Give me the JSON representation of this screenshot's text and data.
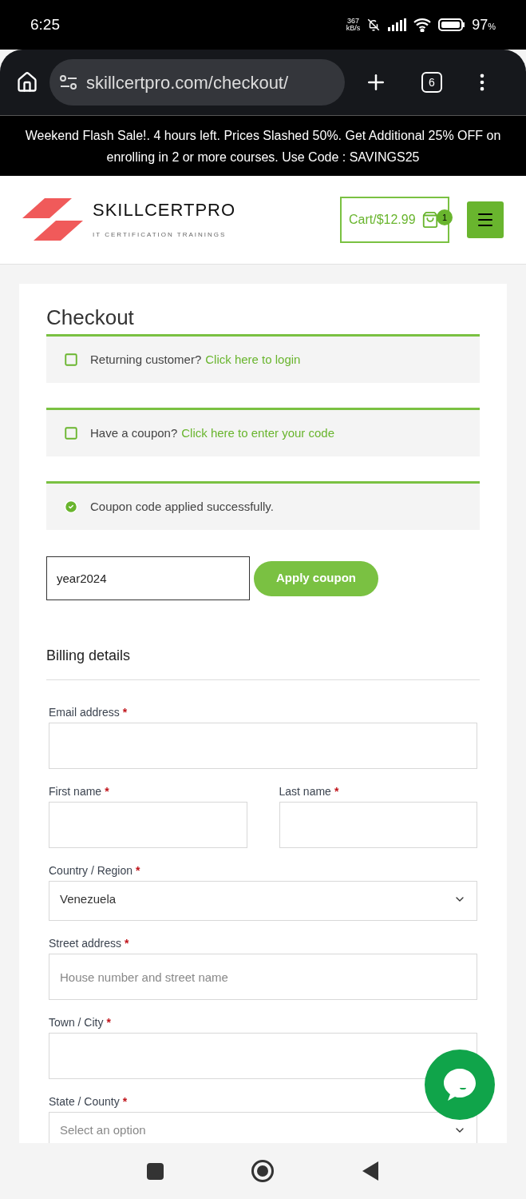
{
  "status_bar": {
    "time": "6:25",
    "net_speed": "367",
    "net_unit": "kB/s",
    "battery": "97",
    "battery_unit": "%"
  },
  "browser": {
    "url": "skillcertpro.com/checkout/",
    "tab_count": "6"
  },
  "promo_banner": {
    "text": "Weekend Flash Sale!. 4 hours left. Prices Slashed 50%. Get Additional 25% OFF on enrolling in 2 or more courses. Use Code : SAVINGS25"
  },
  "header": {
    "logo_title": "SKILLCERTPRO",
    "logo_tagline": "IT CERTIFICATION TRAININGS",
    "cart": "Cart/$12.99",
    "cart_count": "1"
  },
  "checkout": {
    "title": "Checkout",
    "notices": [
      {
        "kind": "info",
        "text": "Returning customer?",
        "link": "Click here to login"
      },
      {
        "kind": "info",
        "text": "Have a coupon?",
        "link": "Click here to enter your code"
      },
      {
        "kind": "success",
        "text": "Coupon code applied successfully."
      }
    ],
    "coupon": {
      "value": "year2024",
      "button": "Apply coupon"
    },
    "billing": {
      "title": "Billing details",
      "rows": [
        [
          {
            "kind": "text",
            "label": "Email address",
            "required_mark": "*"
          }
        ],
        [
          {
            "kind": "text",
            "label": "First name",
            "required_mark": "*"
          },
          {
            "kind": "text",
            "label": "Last name",
            "required_mark": "*"
          }
        ],
        [
          {
            "kind": "select",
            "label": "Country / Region",
            "required_mark": "*",
            "value": "Venezuela"
          }
        ],
        [
          {
            "kind": "text",
            "label": "Street address",
            "required_mark": "*",
            "placeholder": "House number and street name"
          }
        ],
        [
          {
            "kind": "text",
            "label": "Town / City",
            "required_mark": "*"
          }
        ],
        [
          {
            "kind": "select",
            "label": "State / County",
            "required_mark": "*",
            "placeholder": "Select an option"
          }
        ]
      ]
    }
  }
}
